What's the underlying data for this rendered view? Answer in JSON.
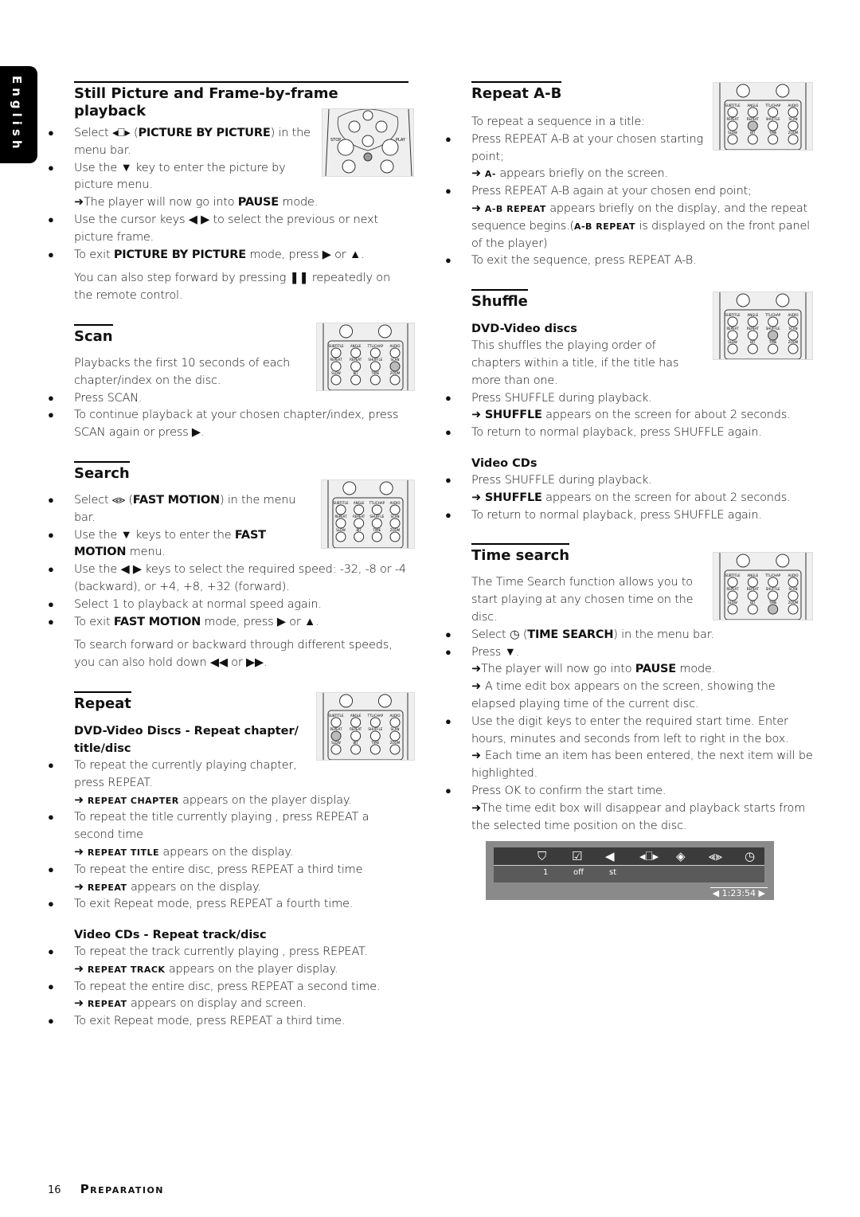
{
  "side_tab": "English",
  "sections": {
    "still": {
      "title": "Still Picture and Frame-by-frame playback",
      "b1_pre": "Select ",
      "b1_icon": "picture-by-picture-icon",
      "b1_bold": "PICTURE BY PICTURE",
      "b1_post": " in the menu bar.",
      "b2": "Use the ▼ key to enter the picture by picture menu.",
      "b2_res_pre": "The player will now go into ",
      "b2_res_bold": "PAUSE",
      "b2_res_post": " mode.",
      "b3": "Use the cursor keys ◀ ▶ to select the previous or next picture frame.",
      "b4_pre": "To exit ",
      "b4_bold": "PICTURE BY PICTURE",
      "b4_post": " mode, press ▶ or ▲.",
      "note": "You can also step forward by pressing ❚❚ repeatedly on the remote control."
    },
    "scan": {
      "title": "Scan",
      "intro": "Playbacks the first 10 seconds of each chapter/index on the disc.",
      "b1": "Press SCAN.",
      "b2": "To continue playback at your chosen chapter/index, press SCAN again or press ▶."
    },
    "search": {
      "title": "Search",
      "b1_pre": "Select ",
      "b1_bold": "FAST MOTION",
      "b1_post": " in the menu bar.",
      "b2_pre": "Use the ▼ keys to enter the ",
      "b2_bold": "FAST MOTION",
      "b2_post": " menu.",
      "b3": "Use the ◀ ▶ keys to select the required speed: -32, -8 or -4 (backward), or +4, +8, +32 (forward).",
      "b4": "Select 1 to playback at normal speed again.",
      "b5_pre": "To exit ",
      "b5_bold": "FAST MOTION",
      "b5_post": " mode, press ▶ or ▲.",
      "note": "To search forward or backward through different speeds, you can also hold down ◀◀ or ▶▶."
    },
    "repeat": {
      "title": "Repeat",
      "sub1": "DVD-Video Discs - Repeat chapter/ title/disc",
      "b1": "To repeat the currently playing chapter, press REPEAT.",
      "b1_res_sc": "REPEAT CHAPTER",
      "b1_res": " appears on the player display.",
      "b2": "To repeat the title currently playing , press REPEAT a second time",
      "b2_res_sc": "REPEAT TITLE",
      "b2_res": " appears on the display.",
      "b3": "To repeat the entire disc, press REPEAT a third time",
      "b3_res_sc": "REPEAT",
      "b3_res": " appears on the display.",
      "b4": "To exit Repeat mode, press REPEAT a fourth time.",
      "sub2": "Video CDs - Repeat track/disc",
      "c1": "To repeat the track currently playing , press REPEAT.",
      "c1_res_sc": "REPEAT TRACK",
      "c1_res": " appears on the player display.",
      "c2": "To repeat the entire disc, press REPEAT a second time.",
      "c2_res_sc": "REPEAT",
      "c2_res": " appears on display and screen.",
      "c3": "To exit Repeat mode, press REPEAT a third time."
    },
    "repeat_ab": {
      "title": "Repeat A-B",
      "intro": "To repeat a sequence in a title:",
      "b1": "Press REPEAT A-B at your chosen starting point;",
      "b1_res_sc": "A-",
      "b1_res": " appears briefly on the screen.",
      "b2": "Press REPEAT A-B again at your chosen end point;",
      "b2_res_sc": "A-B REPEAT",
      "b2_res": " appears briefly on the display, and the repeat sequence begins.(",
      "b2_res_sc2": "A-B REPEAT",
      "b2_res2": " is displayed on the front panel of the player)",
      "b3": "To exit the sequence, press REPEAT A-B."
    },
    "shuffle": {
      "title": "Shuffle",
      "sub1": "DVD-Video discs",
      "intro": "This shuffles the playing order of chapters within a title, if the title has more than one.",
      "b1": "Press SHUFFLE during playback.",
      "b1_res_bold": "SHUFFLE",
      "b1_res": " appears on the screen for about 2 seconds.",
      "b2": "To return to normal playback, press SHUFFLE again.",
      "sub2": "Video CDs",
      "c1": "Press SHUFFLE during playback.",
      "c1_res_bold": "SHUFFLE",
      "c1_res": " appears on the screen for about 2 seconds.",
      "c2": "To return to normal playback, press SHUFFLE again."
    },
    "time_search": {
      "title": "Time search",
      "intro": "The Time Search function allows you to start playing at any chosen time on the disc.",
      "b1_pre": "Select ",
      "b1_bold": "TIME SEARCH",
      "b1_post": " in the menu bar.",
      "b2": "Press ▼.",
      "b2_res1_pre": "The player will now go into ",
      "b2_res1_bold": "PAUSE",
      "b2_res1_post": " mode.",
      "b2_res2": "A time edit box appears on the screen, showing the elapsed playing time of the current disc.",
      "b3": "Use the digit keys to enter the required start time. Enter hours, minutes and seconds from left to right in the box.",
      "b3_res": "Each time an item has been entered, the next item will be highlighted.",
      "b4": "Press OK to confirm the start time.",
      "b4_res": "The time edit box will disappear and playback starts from the selected time position on the disc."
    }
  },
  "remote": {
    "labels": [
      "SUBTITLE",
      "ANGLE",
      "TTL/CHAP",
      "AUDIO",
      "REPEAT",
      "REPEAT",
      "SHUFFLE",
      "SCAN",
      "SLOW",
      "BIT",
      "TIME",
      "ZOOM",
      "RATE",
      "SEARCH"
    ],
    "stop": "STOP",
    "play": "PLAY"
  },
  "osd": {
    "icons": [
      "paint-bucket-icon",
      "checkbox-icon",
      "audio-icon",
      "picture-by-picture-icon",
      "slow-motion-icon",
      "fast-motion-icon",
      "time-search-icon"
    ],
    "values": [
      "1",
      "off",
      "st"
    ],
    "time": "1:23:54"
  },
  "footer": {
    "page": "16",
    "section": "Preparation"
  }
}
